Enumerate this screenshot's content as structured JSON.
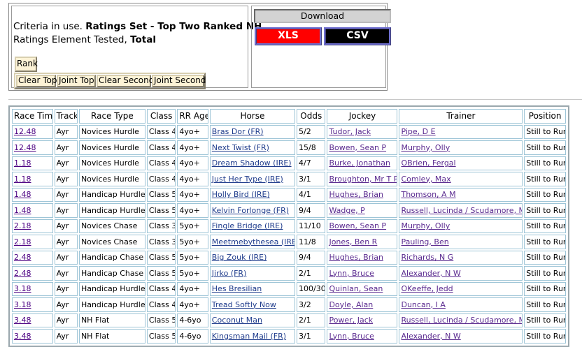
{
  "criteria": {
    "prefix": "Criteria in use. ",
    "set": "Ratings Set - Top Two Ranked NH",
    "element_prefix": "Ratings Element Tested, ",
    "element": "Total"
  },
  "buttons": {
    "rank": "Rank",
    "clear_top": "Clear Top",
    "joint_top": "Joint Top",
    "clear_second": "Clear Second",
    "joint_second": "Joint Second"
  },
  "download": {
    "title": "Download",
    "xls": "XLS",
    "csv": "CSV",
    "xls_color": "#ff0000",
    "csv_color": "#000000"
  },
  "table": {
    "columns": [
      "Race Time",
      "Track",
      "Race Type",
      "Class",
      "RR Age",
      "Horse",
      "Odds",
      "Jockey",
      "Trainer",
      "Position"
    ],
    "rows": [
      [
        "12.48",
        "Ayr",
        "Novices Hurdle",
        "Class 4",
        "4yo+",
        "Bras Dor (FR)",
        "5/2",
        "Tudor, Jack",
        "Pipe, D E",
        "Still to Run"
      ],
      [
        "12.48",
        "Ayr",
        "Novices Hurdle",
        "Class 4",
        "4yo+",
        "Next Twist (FR)",
        "15/8",
        "Bowen, Sean P",
        "Murphy, Olly",
        "Still to Run"
      ],
      [
        "1.18",
        "Ayr",
        "Novices Hurdle",
        "Class 4",
        "4yo+",
        "Dream Shadow (IRE)",
        "4/7",
        "Burke, Jonathan",
        "OBrien, Fergal",
        "Still to Run"
      ],
      [
        "1.18",
        "Ayr",
        "Novices Hurdle",
        "Class 4",
        "4yo+",
        "Just Her Type (IRE)",
        "3/1",
        "Broughton, Mr T P",
        "Comley, Max",
        "Still to Run"
      ],
      [
        "1.48",
        "Ayr",
        "Handicap Hurdle",
        "Class 5",
        "4yo+",
        "Holly Bird (IRE)",
        "4/1",
        "Hughes, Brian",
        "Thomson, A M",
        "Still to Run"
      ],
      [
        "1.48",
        "Ayr",
        "Handicap Hurdle",
        "Class 5",
        "4yo+",
        "Kelvin Forlonge (FR)",
        "9/4",
        "Wadge, P",
        "Russell, Lucinda / Scudamore, M",
        "Still to Run"
      ],
      [
        "2.18",
        "Ayr",
        "Novices Chase",
        "Class 3",
        "5yo+",
        "Fingle Bridge (IRE)",
        "11/10",
        "Bowen, Sean P",
        "Murphy, Olly",
        "Still to Run"
      ],
      [
        "2.18",
        "Ayr",
        "Novices Chase",
        "Class 3",
        "5yo+",
        "Meetmebythesea (IRE)",
        "11/8",
        "Jones, Ben R",
        "Pauling, Ben",
        "Still to Run"
      ],
      [
        "2.48",
        "Ayr",
        "Handicap Chase",
        "Class 5",
        "5yo+",
        "Big Zouk (IRE)",
        "9/4",
        "Hughes, Brian",
        "Richards, N G",
        "Still to Run"
      ],
      [
        "2.48",
        "Ayr",
        "Handicap Chase",
        "Class 5",
        "5yo+",
        "Jirko (FR)",
        "2/1",
        "Lynn, Bruce",
        "Alexander, N W",
        "Still to Run"
      ],
      [
        "3.18",
        "Ayr",
        "Handicap Hurdle",
        "Class 4",
        "4yo+",
        "Hes Bresilian",
        "100/30",
        "Quinlan, Sean",
        "OKeeffe, Jedd",
        "Still to Run"
      ],
      [
        "3.18",
        "Ayr",
        "Handicap Hurdle",
        "Class 4",
        "4yo+",
        "Tread Softly Now",
        "3/2",
        "Doyle, Alan",
        "Duncan, I A",
        "Still to Run"
      ],
      [
        "3.48",
        "Ayr",
        "NH Flat",
        "Class 5",
        "4-6yo",
        "Coconut Man",
        "2/1",
        "Power, Jack",
        "Russell, Lucinda / Scudamore, M",
        "Still to Run"
      ],
      [
        "3.48",
        "Ayr",
        "NH Flat",
        "Class 5",
        "4-6yo",
        "Kingsman Mail (FR)",
        "3/1",
        "Lynn, Bruce",
        "Alexander, N W",
        "Still to Run"
      ]
    ]
  }
}
